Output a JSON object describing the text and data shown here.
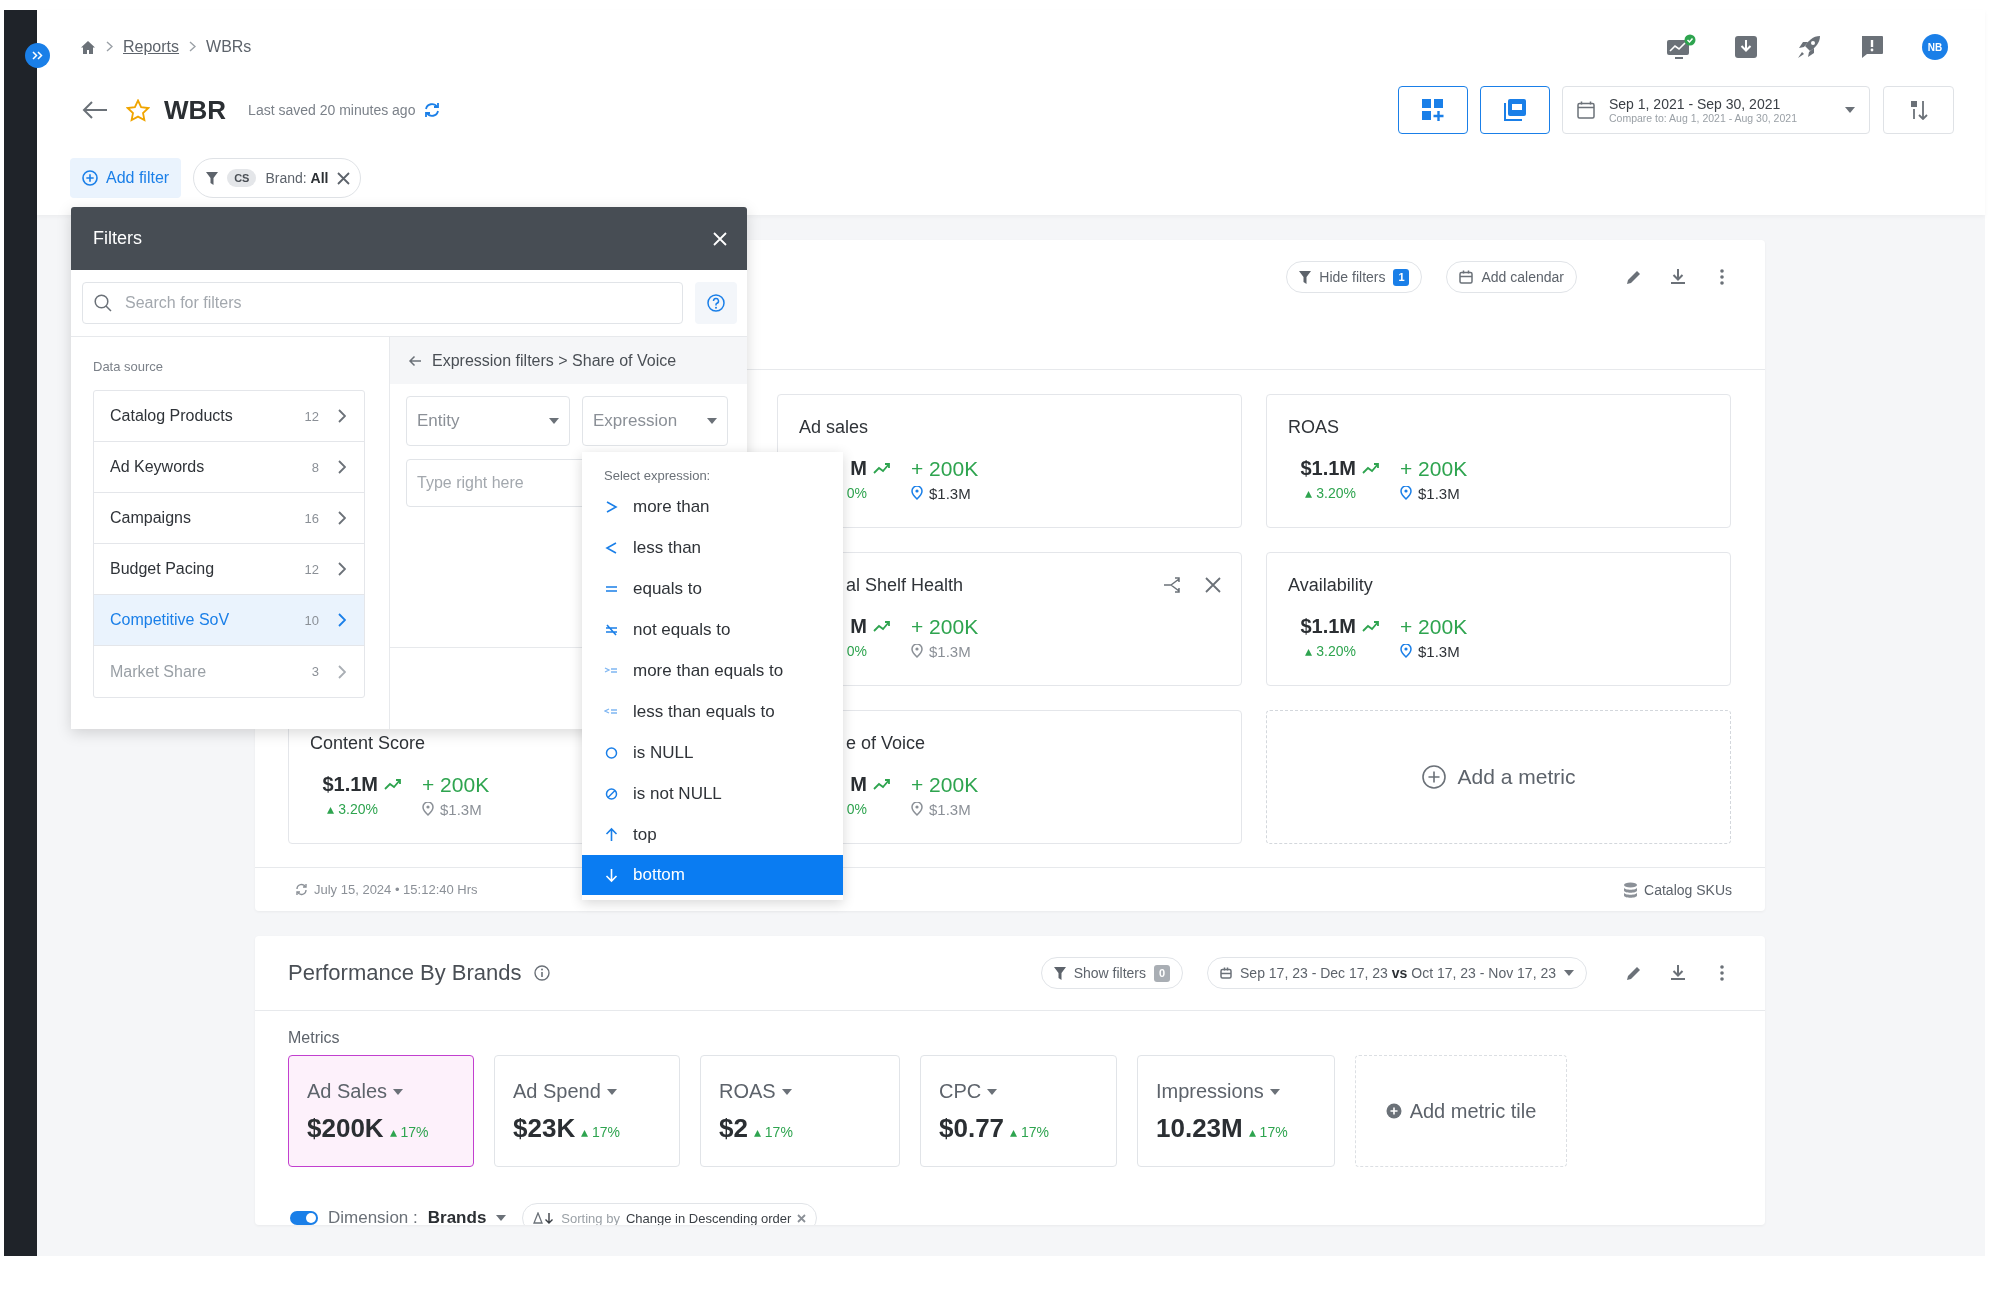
{
  "breadcrumb": [
    {
      "label": "Reports",
      "link": true
    },
    {
      "label": "WBRs",
      "link": false
    }
  ],
  "title": "WBR",
  "starred": true,
  "last_saved": "Last saved 20 minutes ago",
  "user_initials": "NB",
  "date_range": {
    "range": "Sep 1, 2021 - Sep 30, 2021",
    "compare": "Compare to: Aug 1, 2021 - Aug 30, 2021"
  },
  "add_filter": "Add filter",
  "filter_chip": {
    "tag": "CS",
    "label": "Brand: **All**"
  },
  "filters_panel": {
    "title": "Filters",
    "search_placeholder": "Search for filters",
    "data_source_label": "Data source",
    "sources": [
      {
        "name": "Catalog Products",
        "count": "12",
        "selected": false,
        "disabled": false
      },
      {
        "name": "Ad Keywords",
        "count": "8",
        "selected": false,
        "disabled": false
      },
      {
        "name": "Campaigns",
        "count": "16",
        "selected": false,
        "disabled": false
      },
      {
        "name": "Budget Pacing",
        "count": "12",
        "selected": false,
        "disabled": false
      },
      {
        "name": "Competitive SoV",
        "count": "10",
        "selected": true,
        "disabled": false
      },
      {
        "name": "Market Share",
        "count": "3",
        "selected": false,
        "disabled": true
      }
    ],
    "path": "Expression filters > Share of Voice",
    "entity_placeholder": "Entity",
    "expression_placeholder": "Expression",
    "value_placeholder": "Type right here",
    "dropdown": {
      "heading": "Select expression:",
      "options": [
        {
          "kind": "gt",
          "label": "more than",
          "selected": false
        },
        {
          "kind": "lt",
          "label": "less than",
          "selected": false
        },
        {
          "kind": "eq",
          "label": "equals to",
          "selected": false
        },
        {
          "kind": "ne",
          "label": "not equals to",
          "selected": false
        },
        {
          "kind": "gte",
          "label": "more than equals to",
          "selected": false
        },
        {
          "kind": "lte",
          "label": "less than equals to",
          "selected": false
        },
        {
          "kind": "null",
          "label": "is NULL",
          "selected": false
        },
        {
          "kind": "notnull",
          "label": "is not NULL",
          "selected": false
        },
        {
          "kind": "top",
          "label": "top",
          "selected": false
        },
        {
          "kind": "bottom",
          "label": "bottom",
          "selected": true
        }
      ]
    }
  },
  "summary_card": {
    "hide_filters": "Hide filters",
    "filter_count": "1",
    "filters_active": true,
    "add_calendar": "Add calendar",
    "metrics": [
      {
        "title": "Ad sales",
        "value": "M",
        "change": "0%",
        "delta": "+ 200K",
        "target": "$1.3M",
        "title_clipped": false,
        "target_muted": false,
        "actions_shown": false
      },
      {
        "title": "ROAS",
        "value": "$1.1M",
        "change": "▴ 3.20%",
        "delta": "+ 200K",
        "target": "$1.3M",
        "title_clipped": false,
        "target_muted": false,
        "actions_shown": false
      },
      {
        "title": "al Shelf Health",
        "value": "M",
        "change": "0%",
        "delta": "+ 200K",
        "target": "$1.3M",
        "title_clipped": true,
        "target_muted": true,
        "actions_shown": true
      },
      {
        "title": "Availability",
        "value": "$1.1M",
        "change": "▴ 3.20%",
        "delta": "+ 200K",
        "target": "$1.3M",
        "title_clipped": false,
        "target_muted": false,
        "actions_shown": false
      },
      {
        "title": "Content Score",
        "value": "$1.1M",
        "change": "▴ 3.20%",
        "delta": "+ 200K",
        "target": "$1.3M",
        "title_clipped": false,
        "target_muted": true,
        "actions_shown": false
      },
      {
        "title": "e of Voice",
        "value": "M",
        "change": "0%",
        "delta": "+ 200K",
        "target": "$1.3M",
        "title_clipped": true,
        "target_muted": true,
        "actions_shown": false
      }
    ],
    "add_metric": "Add a metric",
    "updated": "July 15, 2024 • 15:12:40 Hrs",
    "source": "Catalog SKUs"
  },
  "brands_card": {
    "title": "Performance By Brands",
    "show_filters": "Show filters",
    "filter_count": "0",
    "filters_active": false,
    "date_range": "Sep 17, 23 - Dec 17, 23 **vs** Oct 17, 23 - Nov 17, 23",
    "metrics_label": "Metrics",
    "tiles": [
      {
        "name": "Ad Sales",
        "value": "$200K",
        "change": "▴ 17%",
        "selected": true
      },
      {
        "name": "Ad Spend",
        "value": "$23K",
        "change": "▴ 17%",
        "selected": false
      },
      {
        "name": "ROAS",
        "value": "$2",
        "change": "▴ 17%",
        "selected": false
      },
      {
        "name": "CPC",
        "value": "$0.77",
        "change": "▴ 17%",
        "selected": false
      },
      {
        "name": "Impressions",
        "value": "10.23M",
        "change": "▴ 17%",
        "selected": false
      }
    ],
    "add_tile": "Add metric tile",
    "dimension_on": true,
    "dimension_label": "Dimension :",
    "dimension_value": "Brands",
    "sort_prefix": "Sorting by",
    "sort_value": "Change in Descending order"
  }
}
